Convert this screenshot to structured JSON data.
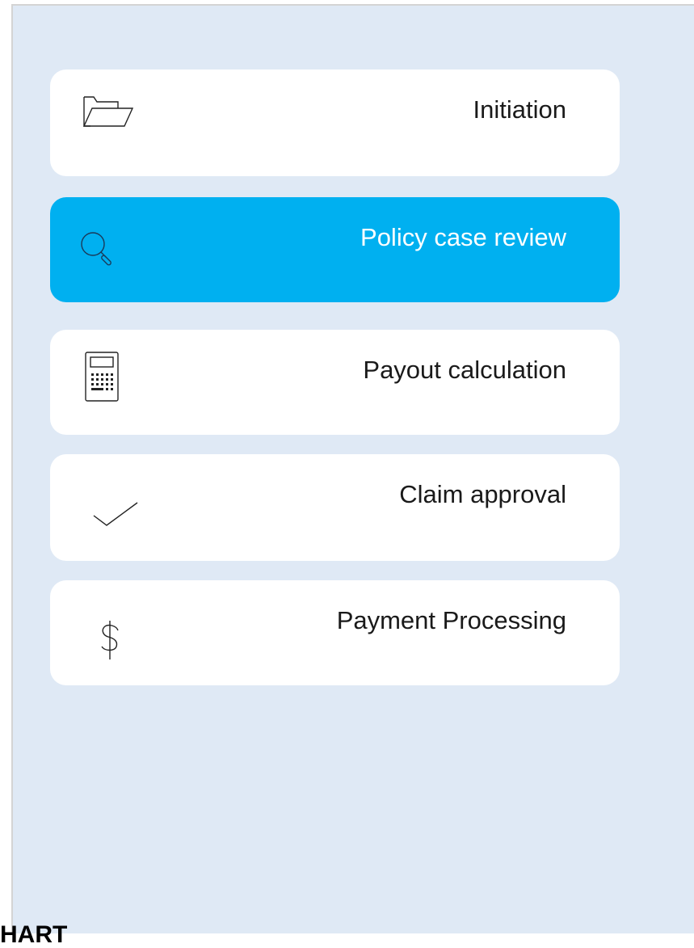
{
  "steps": [
    {
      "label": "Initiation",
      "icon": "folder-open-icon",
      "active": false
    },
    {
      "label": "Policy case review",
      "icon": "magnifier-icon",
      "active": true
    },
    {
      "label": "Payout calculation",
      "icon": "calculator-icon",
      "active": false
    },
    {
      "label": "Claim approval",
      "icon": "checkmark-icon",
      "active": false
    },
    {
      "label": "Payment Processing",
      "icon": "dollar-icon",
      "active": false
    }
  ],
  "footer": {
    "text": "HART"
  },
  "colors": {
    "panel_bg": "#dfe9f5",
    "card_bg": "#ffffff",
    "active_bg": "#00b0f0",
    "active_text": "#ffffff",
    "text": "#1a1a1a"
  }
}
